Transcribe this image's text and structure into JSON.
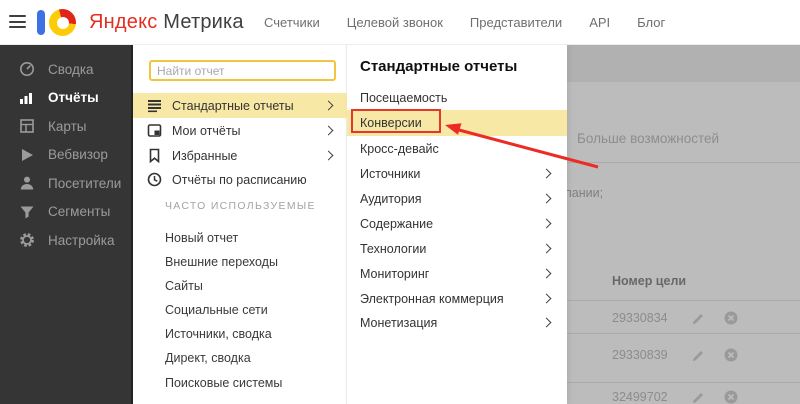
{
  "topbar": {
    "brand": {
      "first": "Яндекс",
      "second": "Метрика"
    },
    "nav": [
      {
        "label": "Счетчики"
      },
      {
        "label": "Целевой звонок"
      },
      {
        "label": "Представители"
      },
      {
        "label": "API"
      },
      {
        "label": "Блог"
      }
    ]
  },
  "sidebar": {
    "items": [
      {
        "label": "Сводка",
        "icon": "gauge-icon",
        "active": false
      },
      {
        "label": "Отчёты",
        "icon": "bar-chart-icon",
        "active": true
      },
      {
        "label": "Карты",
        "icon": "map-grid-icon",
        "active": false
      },
      {
        "label": "Вебвизор",
        "icon": "play-icon",
        "active": false
      },
      {
        "label": "Посетители",
        "icon": "person-icon",
        "active": false
      },
      {
        "label": "Сегменты",
        "icon": "funnel-icon",
        "active": false
      },
      {
        "label": "Настройка",
        "icon": "gear-icon",
        "active": false
      }
    ]
  },
  "reports_menu": {
    "search_placeholder": "Найти отчет",
    "items": [
      {
        "label": "Стандартные отчеты",
        "icon": "stack-icon",
        "has_chevron": true,
        "active": true
      },
      {
        "label": "Мои отчёты",
        "icon": "window-icon",
        "has_chevron": true,
        "active": false
      },
      {
        "label": "Избранные",
        "icon": "bookmark-icon",
        "has_chevron": true,
        "active": false
      },
      {
        "label": "Отчёты по расписанию",
        "icon": "clock-icon",
        "has_chevron": false,
        "active": false
      }
    ],
    "section_title": "ЧАСТО ИСПОЛЬЗУЕМЫЕ",
    "frequent": [
      "Новый отчет",
      "Внешние переходы",
      "Сайты",
      "Социальные сети",
      "Источники, сводка",
      "Директ, сводка",
      "Поисковые системы"
    ]
  },
  "submenu": {
    "title": "Стандартные отчеты",
    "items": [
      {
        "label": "Посещаемость",
        "has_chevron": false,
        "highlighted": false
      },
      {
        "label": "Конверсии",
        "has_chevron": false,
        "highlighted": true
      },
      {
        "label": "Кросс-девайс",
        "has_chevron": false,
        "highlighted": false
      },
      {
        "label": "Источники",
        "has_chevron": true,
        "highlighted": false
      },
      {
        "label": "Аудитория",
        "has_chevron": true,
        "highlighted": false
      },
      {
        "label": "Содержание",
        "has_chevron": true,
        "highlighted": false
      },
      {
        "label": "Технологии",
        "has_chevron": true,
        "highlighted": false
      },
      {
        "label": "Мониторинг",
        "has_chevron": true,
        "highlighted": false
      },
      {
        "label": "Электронная коммерция",
        "has_chevron": true,
        "highlighted": false
      },
      {
        "label": "Монетизация",
        "has_chevron": true,
        "highlighted": false
      }
    ]
  },
  "background_page": {
    "link": "Больше возможностей",
    "text_fragment": "пании;",
    "goals_table": {
      "header": "Номер цели",
      "rows": [
        {
          "goal_id": "29330834"
        },
        {
          "goal_id": "29330839"
        },
        {
          "goal_id": "32499702"
        }
      ]
    }
  },
  "icons": {
    "hamburger-icon": "three horizontal lines",
    "metrika-logo": "blue bar + yellow/red donut",
    "gauge-icon": "speedometer",
    "bar-chart-icon": "ascending bars",
    "map-grid-icon": "grid square",
    "play-icon": "triangle",
    "person-icon": "user silhouette",
    "funnel-icon": "filter funnel",
    "gear-icon": "settings cog",
    "stack-icon": "stacked lines",
    "window-icon": "report window",
    "bookmark-icon": "bookmark",
    "clock-icon": "clock",
    "pencil-icon": "edit pencil",
    "x-circle-icon": "delete circle",
    "chevron-right-icon": ">"
  },
  "colors": {
    "accent_yellow": "#f8e8a6",
    "search_border_yellow": "#f0c63e",
    "annotation_red": "#e6352b",
    "sidebar_bg": "#353535",
    "brand_red": "#e52e22",
    "brand_blue": "#3e70e5",
    "brand_yellow": "#fdcc08",
    "dim_overlay": "#bcbcbc"
  }
}
